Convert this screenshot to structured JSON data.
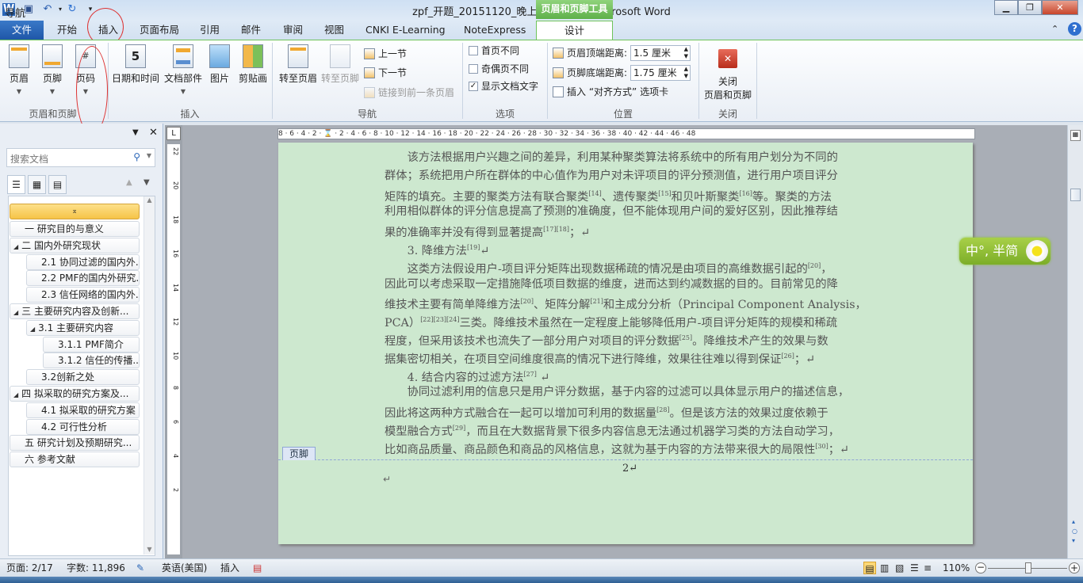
{
  "window": {
    "title": "zpf_开题_20151120_晚上_V1.docx - Microsoft Word",
    "context_tool": "页眉和页脚工具"
  },
  "tabs": [
    {
      "label": "文件"
    },
    {
      "label": "开始"
    },
    {
      "label": "插入"
    },
    {
      "label": "页面布局"
    },
    {
      "label": "引用"
    },
    {
      "label": "邮件"
    },
    {
      "label": "审阅"
    },
    {
      "label": "视图"
    },
    {
      "label": "CNKI E-Learning"
    },
    {
      "label": "NoteExpress"
    },
    {
      "label": "设计"
    }
  ],
  "ribbon": {
    "hf": {
      "header": "页眉",
      "footer": "页脚",
      "pagenum": "页码",
      "label": "页眉和页脚"
    },
    "insert": {
      "datetime": "日期和时间",
      "parts": "文档部件",
      "picture": "图片",
      "clipart": "剪贴画",
      "label": "插入"
    },
    "nav": {
      "goto_header": "转至页眉",
      "goto_footer": "转至页脚",
      "prev": "上一节",
      "next": "下一节",
      "link": "链接到前一条页眉",
      "label": "导航"
    },
    "options": {
      "first": "首页不同",
      "oddeven": "奇偶页不同",
      "showtext": "显示文档文字",
      "label": "选项",
      "first_checked": false,
      "oddeven_checked": false,
      "showtext_checked": true
    },
    "position": {
      "header_top": "页眉顶端距离:",
      "header_top_value": "1.5 厘米",
      "footer_bottom": "页脚底端距离:",
      "footer_bottom_value": "1.75 厘米",
      "insert_align": "插入 “对齐方式” 选项卡",
      "label": "位置"
    },
    "close": {
      "button": "关闭",
      "button2": "页眉和页脚",
      "label": "关闭"
    }
  },
  "nav": {
    "title": "导航",
    "search_placeholder": "搜索文档",
    "items": [
      {
        "label": "一 研究目的与意义",
        "level": 0,
        "tri": ""
      },
      {
        "label": "二 国内外研究现状",
        "level": 0,
        "tri": "◢"
      },
      {
        "label": "2.1 协同过滤的国内外...",
        "level": 1,
        "tri": ""
      },
      {
        "label": "2.2 PMF的国内外研究...",
        "level": 1,
        "tri": ""
      },
      {
        "label": "2.3 信任网络的国内外...",
        "level": 1,
        "tri": ""
      },
      {
        "label": "三 主要研究内容及创新...",
        "level": 0,
        "tri": "◢"
      },
      {
        "label": "3.1 主要研究内容",
        "level": 1,
        "tri": "◢"
      },
      {
        "label": "3.1.1  PMF简介",
        "level": 2,
        "tri": ""
      },
      {
        "label": "3.1.2  信任的传播...",
        "level": 2,
        "tri": ""
      },
      {
        "label": "3.2创新之处",
        "level": 1,
        "tri": ""
      },
      {
        "label": "四 拟采取的研究方案及...",
        "level": 0,
        "tri": "◢"
      },
      {
        "label": "4.1 拟采取的研究方案",
        "level": 1,
        "tri": ""
      },
      {
        "label": "4.2 可行性分析",
        "level": 1,
        "tri": ""
      },
      {
        "label": "五 研究计划及预期研究...",
        "level": 0,
        "tri": ""
      },
      {
        "label": "六 参考文献",
        "level": 0,
        "tri": ""
      }
    ]
  },
  "ruler": {
    "h": "8 · 6 · 4 · 2 · ⌛ · 2 · 4 · 6 · 8 · 10 · 12 · 14 · 16 · 18 · 20 · 22 · 24 · 26 · 28 · 30 · 32 · 34 · 36 · 38 · 40 · 42 · 44 · 46 · 48",
    "v": [
      "22",
      "20",
      "18",
      "16",
      "14",
      "12",
      "10",
      "8",
      "6",
      "4",
      "2"
    ]
  },
  "doc": {
    "lines": [
      [
        {
          "t": "　　该方法根据用户兴趣之间的差异，利用某种聚类算法将系统中的所有用户划分为不同的"
        }
      ],
      [
        {
          "t": "群体；系统把用户所在群体的中心值作为用户对未评项目的评分预测值，进行用户项目评分"
        }
      ],
      [
        {
          "t": "矩阵的填充。主要的聚类方法有联合聚类"
        },
        {
          "s": "[14]"
        },
        {
          "t": "、遗传聚类"
        },
        {
          "s": "[15]"
        },
        {
          "t": "和贝叶斯聚类"
        },
        {
          "s": "[16]"
        },
        {
          "t": "等。聚类的方法"
        }
      ],
      [
        {
          "t": "利用相似群体的评分信息提高了预测的准确度，但不能体现用户间的爱好区别，因此推荐结"
        }
      ],
      [
        {
          "t": "果的准确率并没有得到显著提高"
        },
        {
          "s": "[17][18]"
        },
        {
          "t": "；↵"
        }
      ],
      [
        {
          "t": "　　3. 降维方法"
        },
        {
          "s": "[19]"
        },
        {
          "t": "↵"
        }
      ],
      [
        {
          "t": "　　这类方法假设用户-项目评分矩阵出现数据稀疏的情况是由项目的高维数据引起的"
        },
        {
          "s": "[20]"
        },
        {
          "t": "，"
        }
      ],
      [
        {
          "t": "因此可以考虑采取一定措施降低项目数据的维度，进而达到约减数据的目的。目前常见的降"
        }
      ],
      [
        {
          "t": "维技术主要有简单降维方法"
        },
        {
          "s": "[20]"
        },
        {
          "t": "、矩阵分解"
        },
        {
          "s": "[21]"
        },
        {
          "t": "和主成分分析（Principal Component Analysis，"
        }
      ],
      [
        {
          "t": "PCA）"
        },
        {
          "s": "[22][23][24]"
        },
        {
          "t": "三类。降维技术虽然在一定程度上能够降低用户-项目评分矩阵的规模和稀疏"
        }
      ],
      [
        {
          "t": "程度，但采用该技术也流失了一部分用户对项目的评分数据"
        },
        {
          "s": "[25]"
        },
        {
          "t": "。降维技术产生的效果与数"
        }
      ],
      [
        {
          "t": "据集密切相关，在项目空间维度很高的情况下进行降维，效果往往难以得到保证"
        },
        {
          "s": "[26]"
        },
        {
          "t": "；↵"
        }
      ],
      [
        {
          "t": "　　4. 结合内容的过滤方法"
        },
        {
          "s": "[27]"
        },
        {
          "t": "  ↵"
        }
      ],
      [
        {
          "t": "　　协同过滤利用的信息只是用户评分数据，基于内容的过滤可以具体显示用户的描述信息，"
        }
      ],
      [
        {
          "t": "因此将这两种方式融合在一起可以增加可利用的数据量"
        },
        {
          "s": "[28]"
        },
        {
          "t": "。但是该方法的效果过度依赖于"
        }
      ],
      [
        {
          "t": "模型融合方式"
        },
        {
          "s": "[29]"
        },
        {
          "t": "，而且在大数据背景下很多内容信息无法通过机器学习类的方法自动学习，"
        }
      ],
      [
        {
          "t": "比如商品质量、商品颜色和商品的风格信息，这就为基于内容的方法带来很大的局限性"
        },
        {
          "s": "[30]"
        },
        {
          "t": "；↵"
        }
      ]
    ],
    "footer_tag": "页脚",
    "page_number": "2↵",
    "para_mark": "↵"
  },
  "ime": {
    "text": "中°, 半简"
  },
  "status": {
    "page": "页面: 2/17",
    "words": "字数: 11,896",
    "lang": "英语(美国)",
    "mode": "插入",
    "zoom": "110%"
  },
  "colors": {
    "page_bg": "#cde8cf",
    "ribbon_accent": "#6ec35a",
    "file_tab": "#2a66b8"
  }
}
